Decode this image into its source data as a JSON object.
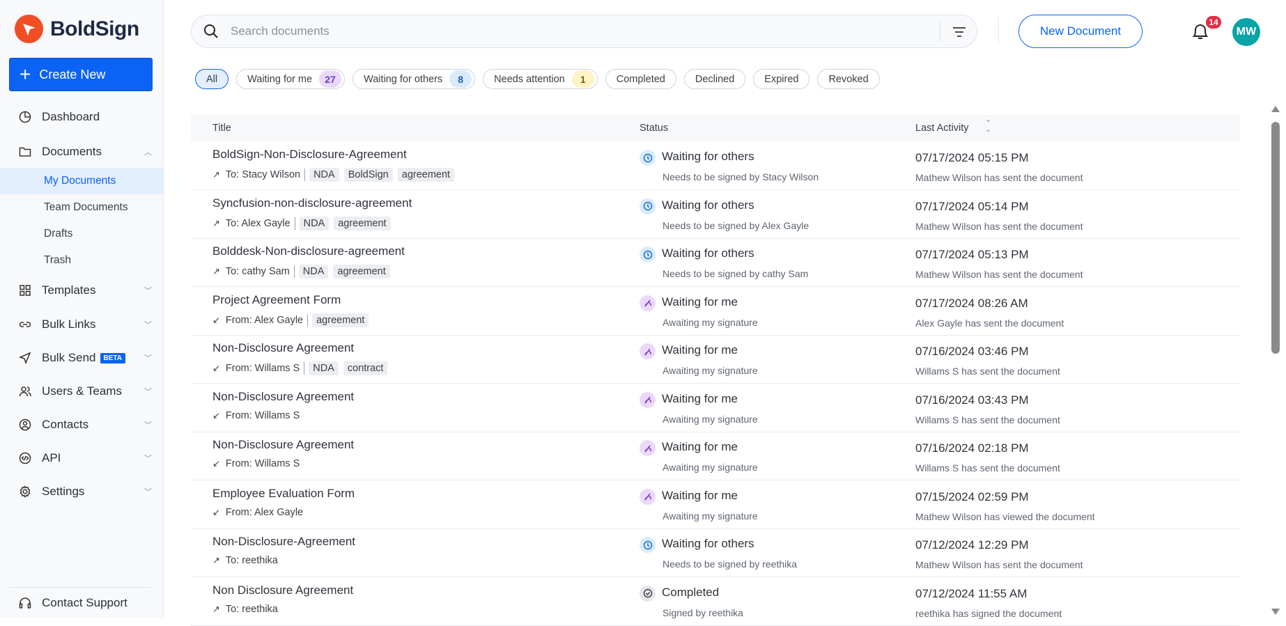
{
  "brand": {
    "name": "BoldSign",
    "color": "#f04e23"
  },
  "sidebar": {
    "create_label": "Create New",
    "items": [
      {
        "label": "Dashboard",
        "icon": "dashboard-icon"
      },
      {
        "label": "Documents",
        "icon": "folder-icon"
      },
      {
        "label": "Templates",
        "icon": "templates-icon"
      },
      {
        "label": "Bulk Links",
        "icon": "link-icon"
      },
      {
        "label": "Bulk Send",
        "icon": "send-icon",
        "badge": "BETA"
      },
      {
        "label": "Users & Teams",
        "icon": "users-icon"
      },
      {
        "label": "Contacts",
        "icon": "contact-icon"
      },
      {
        "label": "API",
        "icon": "api-icon"
      },
      {
        "label": "Settings",
        "icon": "gear-icon"
      }
    ],
    "documents_sub": [
      "My Documents",
      "Team Documents",
      "Drafts",
      "Trash"
    ],
    "contact_support": "Contact Support"
  },
  "header": {
    "search_placeholder": "Search documents",
    "new_document": "New Document",
    "notification_count": "14",
    "avatar_initials": "MW"
  },
  "filters": [
    {
      "label": "All"
    },
    {
      "label": "Waiting for me",
      "count": "27"
    },
    {
      "label": "Waiting for others",
      "count": "8"
    },
    {
      "label": "Needs attention",
      "count": "1"
    },
    {
      "label": "Completed"
    },
    {
      "label": "Declined"
    },
    {
      "label": "Expired"
    },
    {
      "label": "Revoked"
    }
  ],
  "table": {
    "columns": {
      "title": "Title",
      "status": "Status",
      "last_activity": "Last Activity"
    },
    "rows": [
      {
        "title": "BoldSign-Non-Disclosure-Agreement",
        "dir": "out",
        "party": "To: Stacy Wilson",
        "tags": [
          "NDA",
          "BoldSign",
          "agreement"
        ],
        "status": "Waiting for others",
        "status_sub": "Needs to be signed by Stacy Wilson",
        "date": "07/17/2024 05:15 PM",
        "activity": "Mathew Wilson has sent the document"
      },
      {
        "title": "Syncfusion-non-disclosure-agreement",
        "dir": "out",
        "party": "To: Alex Gayle",
        "tags": [
          "NDA",
          "agreement"
        ],
        "status": "Waiting for others",
        "status_sub": "Needs to be signed by Alex Gayle",
        "date": "07/17/2024 05:14 PM",
        "activity": "Mathew Wilson has sent the document"
      },
      {
        "title": "Bolddesk-Non-disclosure-agreement",
        "dir": "out",
        "party": "To: cathy Sam",
        "tags": [
          "NDA",
          "agreement"
        ],
        "status": "Waiting for others",
        "status_sub": "Needs to be signed by cathy Sam",
        "date": "07/17/2024 05:13 PM",
        "activity": "Mathew Wilson has sent the document"
      },
      {
        "title": "Project Agreement Form",
        "dir": "in",
        "party": "From: Alex Gayle",
        "tags": [
          "agreement"
        ],
        "status": "Waiting for me",
        "status_sub": "Awaiting my signature",
        "date": "07/17/2024 08:26 AM",
        "activity": "Alex Gayle has sent the document"
      },
      {
        "title": "Non-Disclosure Agreement",
        "dir": "in",
        "party": "From: Willams S",
        "tags": [
          "NDA",
          "contract"
        ],
        "status": "Waiting for me",
        "status_sub": "Awaiting my signature",
        "date": "07/16/2024 03:46 PM",
        "activity": "Willams S has sent the document"
      },
      {
        "title": "Non-Disclosure Agreement",
        "dir": "in",
        "party": "From: Willams S",
        "tags": [],
        "status": "Waiting for me",
        "status_sub": "Awaiting my signature",
        "date": "07/16/2024 03:43 PM",
        "activity": "Willams S has sent the document"
      },
      {
        "title": "Non-Disclosure Agreement",
        "dir": "in",
        "party": "From: Willams S",
        "tags": [],
        "status": "Waiting for me",
        "status_sub": "Awaiting my signature",
        "date": "07/16/2024 02:18 PM",
        "activity": "Willams S has sent the document"
      },
      {
        "title": "Employee Evaluation Form",
        "dir": "in",
        "party": "From: Alex Gayle",
        "tags": [],
        "status": "Waiting for me",
        "status_sub": "Awaiting my signature",
        "date": "07/15/2024 02:59 PM",
        "activity": "Mathew Wilson has viewed the document"
      },
      {
        "title": "Non-Disclosure-Agreement",
        "dir": "out",
        "party": "To: reethika",
        "tags": [],
        "status": "Waiting for others",
        "status_sub": "Needs to be signed by reethika",
        "date": "07/12/2024 12:29 PM",
        "activity": "Mathew Wilson has sent the document"
      },
      {
        "title": "Non Disclosure Agreement",
        "dir": "out",
        "party": "To: reethika",
        "tags": [],
        "status": "Completed",
        "status_sub": "Signed by reethika",
        "date": "07/12/2024 11:55 AM",
        "activity": "reethika has signed the document"
      }
    ]
  }
}
